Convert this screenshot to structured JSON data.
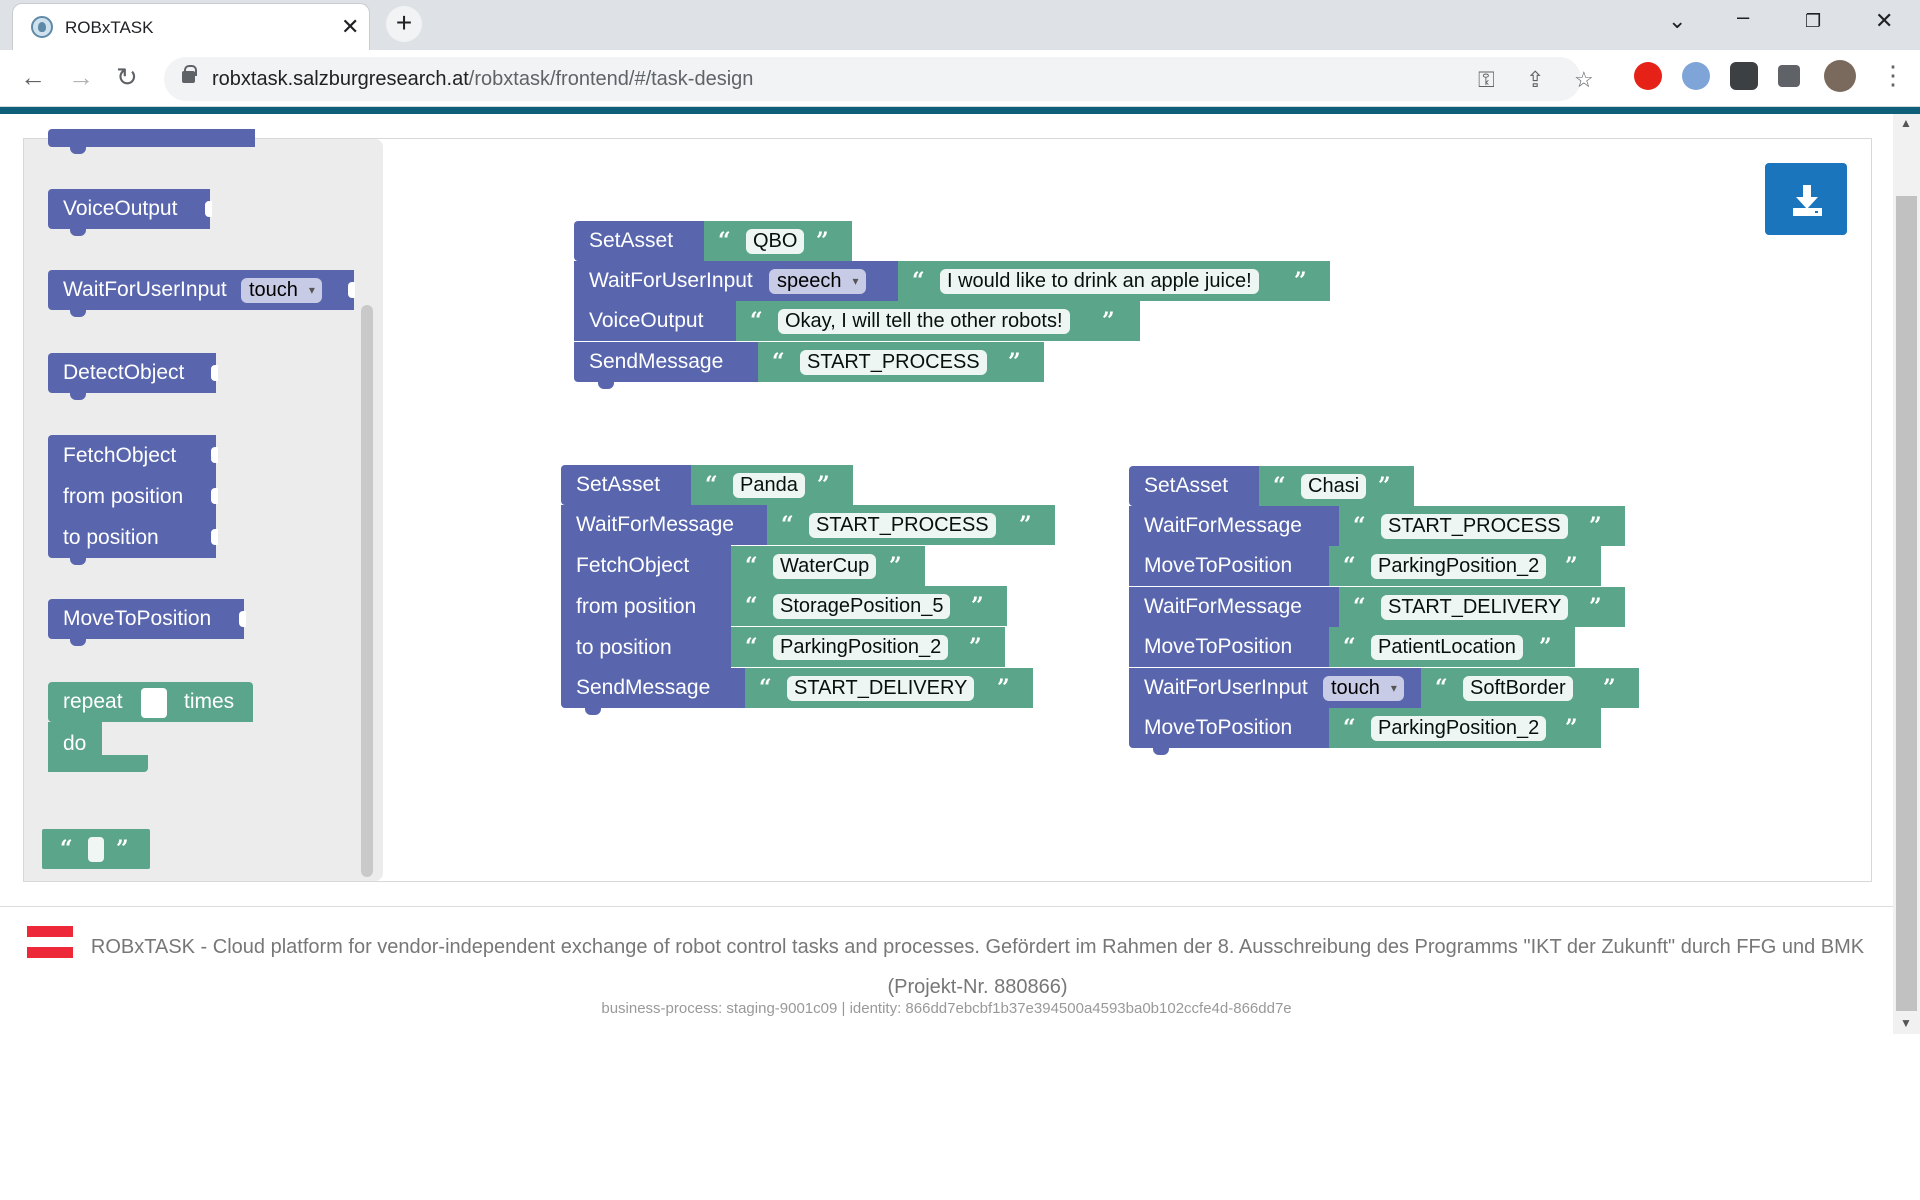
{
  "browser": {
    "tab_title": "ROBxTASK",
    "url_host": "robxtask.salzburgresearch.at",
    "url_path": "/robxtask/frontend/#/task-design",
    "window_controls": [
      "chevron-down-icon",
      "minimize-icon",
      "restore-icon",
      "close-icon"
    ]
  },
  "flyout": {
    "voice_output": "VoiceOutput",
    "wait_for_user_input": "WaitForUserInput",
    "wait_for_user_input_option": "touch",
    "detect_object": "DetectObject",
    "fetch_object": "FetchObject",
    "from_position": "from position",
    "to_position": "to position",
    "move_to_position": "MoveToPosition",
    "repeat": "repeat",
    "times": "times",
    "do": "do"
  },
  "workspace": {
    "qbo": {
      "set_asset": "SetAsset",
      "asset": "QBO",
      "wait_input": "WaitForUserInput",
      "input_mode": "speech",
      "input_text": "I would like to drink an apple juice!",
      "voice_output": "VoiceOutput",
      "voice_text": "Okay, I will tell the other robots!",
      "send_message": "SendMessage",
      "message": "START_PROCESS"
    },
    "panda": {
      "set_asset": "SetAsset",
      "asset": "Panda",
      "wait_message": "WaitForMessage",
      "wait_message_value": "START_PROCESS",
      "fetch_object": "FetchObject",
      "object": "WaterCup",
      "from_position": "from position",
      "from_value": "StoragePosition_5",
      "to_position": "to position",
      "to_value": "ParkingPosition_2",
      "send_message": "SendMessage",
      "message": "START_DELIVERY"
    },
    "chasi": {
      "set_asset": "SetAsset",
      "asset": "Chasi",
      "wait_message_1": "WaitForMessage",
      "wait_message_1_value": "START_PROCESS",
      "move_1": "MoveToPosition",
      "move_1_value": "ParkingPosition_2",
      "wait_message_2": "WaitForMessage",
      "wait_message_2_value": "START_DELIVERY",
      "move_2": "MoveToPosition",
      "move_2_value": "PatientLocation",
      "wait_input": "WaitForUserInput",
      "input_mode": "touch",
      "input_value": "SoftBorder",
      "move_3": "MoveToPosition",
      "move_3_value": "ParkingPosition_2"
    }
  },
  "quote_open": "“",
  "quote_close": "”",
  "footer": {
    "text": "ROBxTASK - Cloud platform for vendor-independent exchange of robot control tasks and processes. Gefördert im Rahmen der 8. Ausschreibung des Programms \"IKT der Zukunft\" durch FFG und BMK (Projekt-Nr. 880866)",
    "meta": "business-process: staging-9001c09 | identity: 866dd7ebcbf1b37e394500a4593ba0b102ccfe4d-866dd7e"
  },
  "colors": {
    "command": "#5966ad",
    "text": "#5ba68a",
    "loop": "#5ba55b",
    "accent": "#1b75bc",
    "header_bar": "#0d5f7a"
  }
}
